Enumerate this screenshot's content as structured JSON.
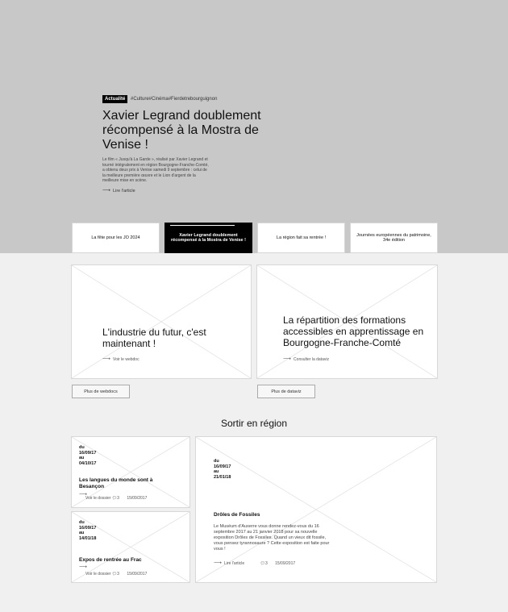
{
  "hero": {
    "badge": "Actualité",
    "tags": "#Culture#Cinéma#Fierdetrebourguignon",
    "title": "Xavier Legrand doublement récompensé à la Mostra de Venise !",
    "text": "Le film « Jusqu'à La Garde », réalisé par Xavier Legrand et tourné intégralement en région Bourgogne-Franche-Comté, a obtenu deux prix à Venise samedi 9 septembre : celui de la meilleure première œuvre et le Lion d'argent de la meilleure mise en scène.",
    "read_link": "Lire l'article"
  },
  "tabs": [
    {
      "label": "La fête pour les JO 2024"
    },
    {
      "label": "Xavier Legrand doublement récompensé à la Mostra de Venise !"
    },
    {
      "label": "La région fait sa rentrée !"
    },
    {
      "label": "Journées européennes du patrimoine, 34e édition"
    }
  ],
  "features": [
    {
      "title": "L'industrie du futur, c'est maintenant !",
      "link": "Voir le webdoc"
    },
    {
      "title": "La répartition des formations accessibles en apprentissage en Bourgogne-Franche-Comté",
      "link": "Consulter la dataviz"
    }
  ],
  "buttons": {
    "more_webdocs": "Plus de webdocs",
    "more_dataviz": "Plus de dataviz"
  },
  "sortir": {
    "title": "Sortir en région",
    "events": [
      {
        "dates": [
          "du",
          "16/09/17",
          "au",
          "04/10/17"
        ],
        "title": "Les langues du monde sont à Besançon",
        "link": "Voir le dossier",
        "comments": "3",
        "date": "15/09/2017"
      },
      {
        "dates": [
          "du",
          "16/09/17",
          "au",
          "14/01/18"
        ],
        "title": "Expos de rentrée au Frac",
        "link": "Voir le dossier",
        "comments": "3",
        "date": "15/09/2017"
      },
      {
        "dates": [
          "du",
          "16/09/17",
          "au",
          "21/01/18"
        ],
        "title": "Drôles de Fossiles",
        "desc": "Le Muséum d'Auxerre vous donne rendez-vous du 16 septembre 2017 au 21 janvier 2018 pour sa nouvelle exposition Drôles de Fossiles. Quand un vieux dit fossile, vous pensez tyrannosaure ? Cette exposition est faite pour vous !",
        "link": "Lire l'article",
        "comments": "3",
        "date": "15/09/2017"
      }
    ]
  },
  "icons": {
    "arrow": "arrow-right-icon",
    "comment": "comment-icon"
  }
}
